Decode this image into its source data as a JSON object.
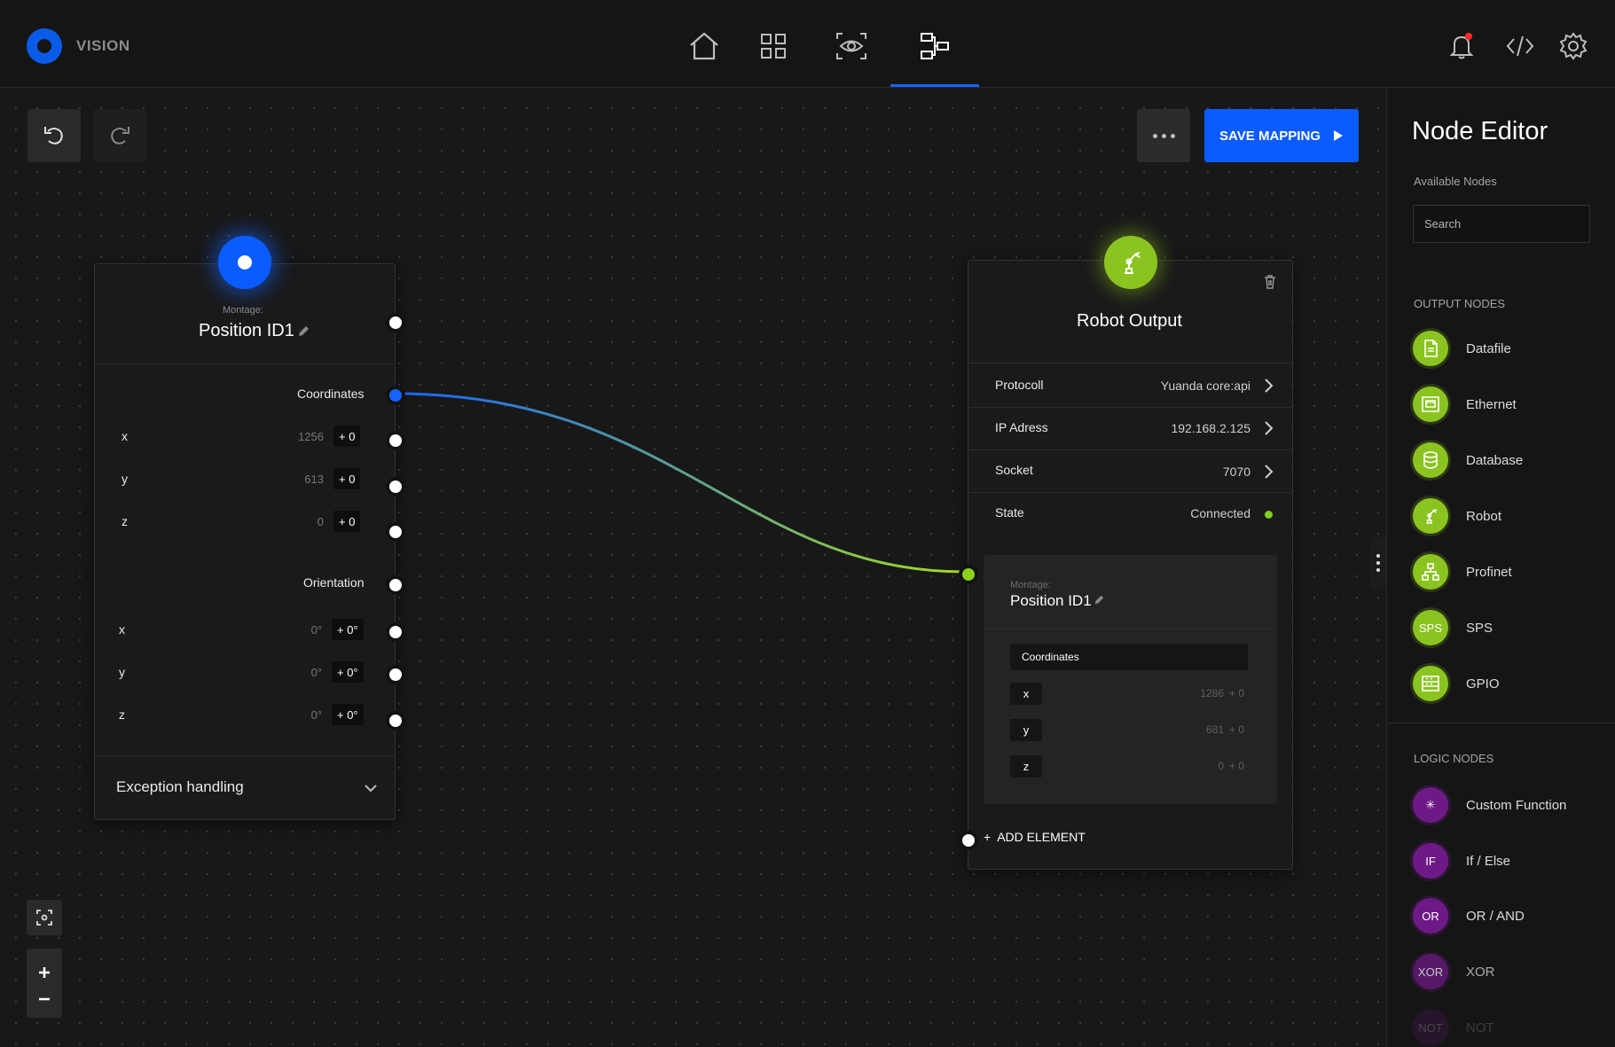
{
  "header": {
    "brand": "VISION",
    "nav": [
      "home-icon",
      "grid-icon",
      "eye-icon",
      "mapping-icon"
    ],
    "right_icons": [
      "bell-icon",
      "code-icon",
      "settings-icon"
    ]
  },
  "toolbar": {
    "undo_icon": "undo-icon",
    "redo_icon": "redo-icon",
    "save_label": "SAVE MAPPING"
  },
  "left_node": {
    "sublabel": "Montage:",
    "title": "Position ID1",
    "coordinates_label": "Coordinates",
    "coords": [
      {
        "axis": "x",
        "value": "1256",
        "offset": "+ 0"
      },
      {
        "axis": "y",
        "value": "613",
        "offset": "+ 0"
      },
      {
        "axis": "z",
        "value": "0",
        "offset": "+ 0"
      }
    ],
    "orientation_label": "Orientation",
    "orient": [
      {
        "axis": "x",
        "value": "0°",
        "offset": "+ 0°"
      },
      {
        "axis": "y",
        "value": "0°",
        "offset": "+ 0°"
      },
      {
        "axis": "z",
        "value": "0°",
        "offset": "+ 0°"
      }
    ],
    "exception_label": "Exception handling"
  },
  "right_node": {
    "title": "Robot Output",
    "rows": [
      {
        "label": "Protocoll",
        "value": "Yuanda core:api"
      },
      {
        "label": "IP Adress",
        "value": "192.168.2.125"
      },
      {
        "label": "Socket",
        "value": "7070"
      },
      {
        "label": "State",
        "value": "Connected"
      }
    ],
    "state_color": "#7bd11c",
    "inner": {
      "sublabel": "Montage:",
      "title": "Position ID1",
      "section": "Coordinates",
      "coords": [
        {
          "axis": "x",
          "value": "1286",
          "offset": "+ 0"
        },
        {
          "axis": "y",
          "value": "681",
          "offset": "+ 0"
        },
        {
          "axis": "z",
          "value": "0",
          "offset": "+ 0"
        }
      ]
    },
    "add_element": "ADD ELEMENT"
  },
  "sidebar": {
    "title": "Node Editor",
    "available_label": "Available Nodes",
    "search_placeholder": "Search",
    "output_label": "OUTPUT NODES",
    "output_nodes": [
      {
        "name": "Datafile",
        "icon": "file-icon"
      },
      {
        "name": "Ethernet",
        "icon": "ethernet-icon"
      },
      {
        "name": "Database",
        "icon": "database-icon"
      },
      {
        "name": "Robot",
        "icon": "robot-icon"
      },
      {
        "name": "Profinet",
        "icon": "network-icon"
      },
      {
        "name": "SPS",
        "icon": "SPS"
      },
      {
        "name": "GPIO",
        "icon": "gpio-icon"
      }
    ],
    "logic_label": "LOGIC NODES",
    "logic_nodes": [
      {
        "name": "Custom Function",
        "icon": "✳"
      },
      {
        "name": "If / Else",
        "icon": "IF"
      },
      {
        "name": "OR / AND",
        "icon": "OR"
      },
      {
        "name": "XOR",
        "icon": "XOR"
      },
      {
        "name": "NOT",
        "icon": "NOT"
      }
    ]
  },
  "colors": {
    "accent": "#0a5cff",
    "green": "#8bc420",
    "purple": "#6e1a86"
  }
}
